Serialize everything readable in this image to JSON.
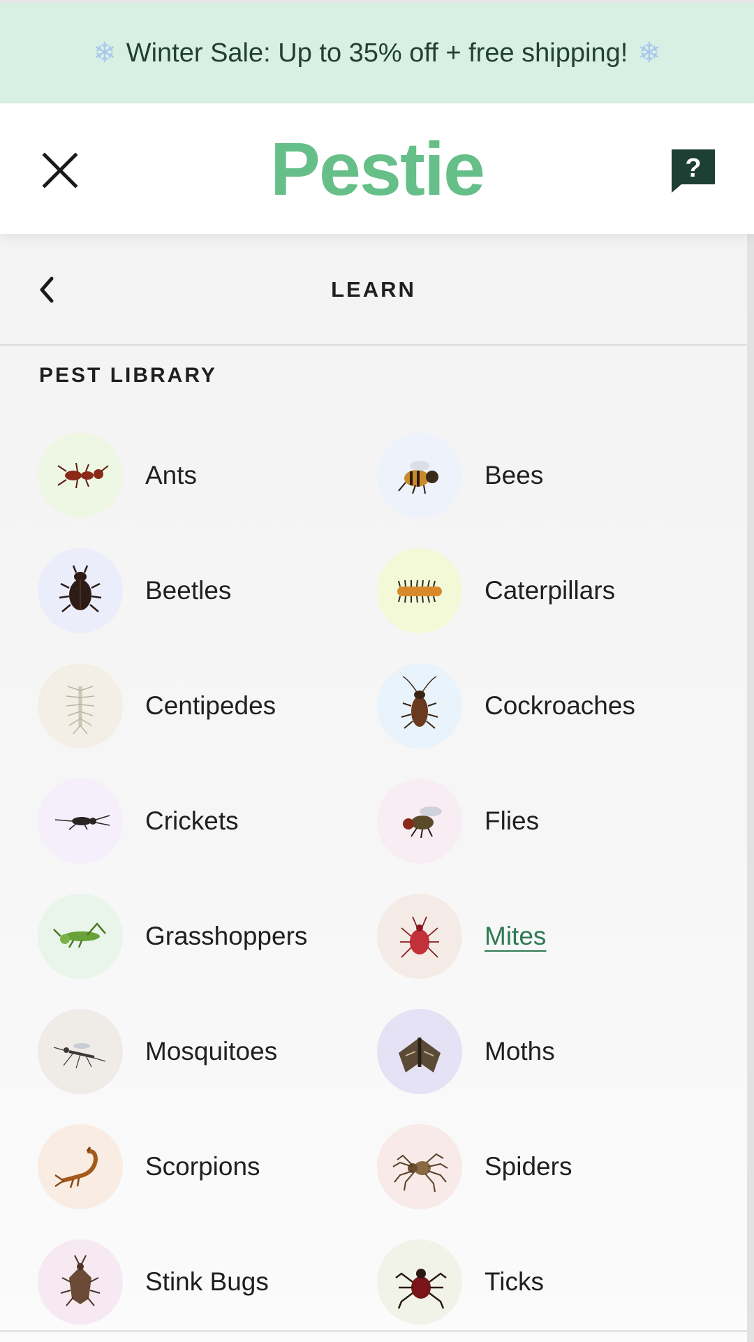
{
  "promo": {
    "text": "Winter Sale: Up to 35% off + free shipping!",
    "icon_left": "snowflake-icon",
    "icon_right": "snowflake-icon"
  },
  "header": {
    "logo": "Pestie",
    "close_icon": "close-icon",
    "help_icon": "help-chat-icon",
    "help_glyph": "?"
  },
  "menu": {
    "back_icon": "chevron-left-icon",
    "title": "LEARN",
    "section_title": "PEST LIBRARY",
    "items": [
      {
        "label": "Ants",
        "icon": "ant-icon",
        "bg": "#eef7e4"
      },
      {
        "label": "Bees",
        "icon": "bee-icon",
        "bg": "#eef2fb"
      },
      {
        "label": "Beetles",
        "icon": "beetle-icon",
        "bg": "#ecedfb"
      },
      {
        "label": "Caterpillars",
        "icon": "caterpillar-icon",
        "bg": "#f3f9d6"
      },
      {
        "label": "Centipedes",
        "icon": "centipede-icon",
        "bg": "#f4efe6"
      },
      {
        "label": "Cockroaches",
        "icon": "cockroach-icon",
        "bg": "#e9f3fb"
      },
      {
        "label": "Crickets",
        "icon": "cricket-icon",
        "bg": "#f4effb"
      },
      {
        "label": "Flies",
        "icon": "fly-icon",
        "bg": "#f8edf3"
      },
      {
        "label": "Grasshoppers",
        "icon": "grasshopper-icon",
        "bg": "#e9f5ea"
      },
      {
        "label": "Mites",
        "icon": "mite-icon",
        "bg": "#f4ebe6",
        "active": true
      },
      {
        "label": "Mosquitoes",
        "icon": "mosquito-icon",
        "bg": "#efece8"
      },
      {
        "label": "Moths",
        "icon": "moth-icon",
        "bg": "#e5e2f5"
      },
      {
        "label": "Scorpions",
        "icon": "scorpion-icon",
        "bg": "#f8ece3"
      },
      {
        "label": "Spiders",
        "icon": "spider-icon",
        "bg": "#f7eae8"
      },
      {
        "label": "Stink Bugs",
        "icon": "stink-bug-icon",
        "bg": "#f6e9f1"
      },
      {
        "label": "Ticks",
        "icon": "tick-icon",
        "bg": "#f1f3e8"
      }
    ]
  },
  "colors": {
    "brand": "#66bf88",
    "promo_bg": "#d7f0e3",
    "active_link": "#2f7a55",
    "help_bg": "#1e3f33"
  }
}
